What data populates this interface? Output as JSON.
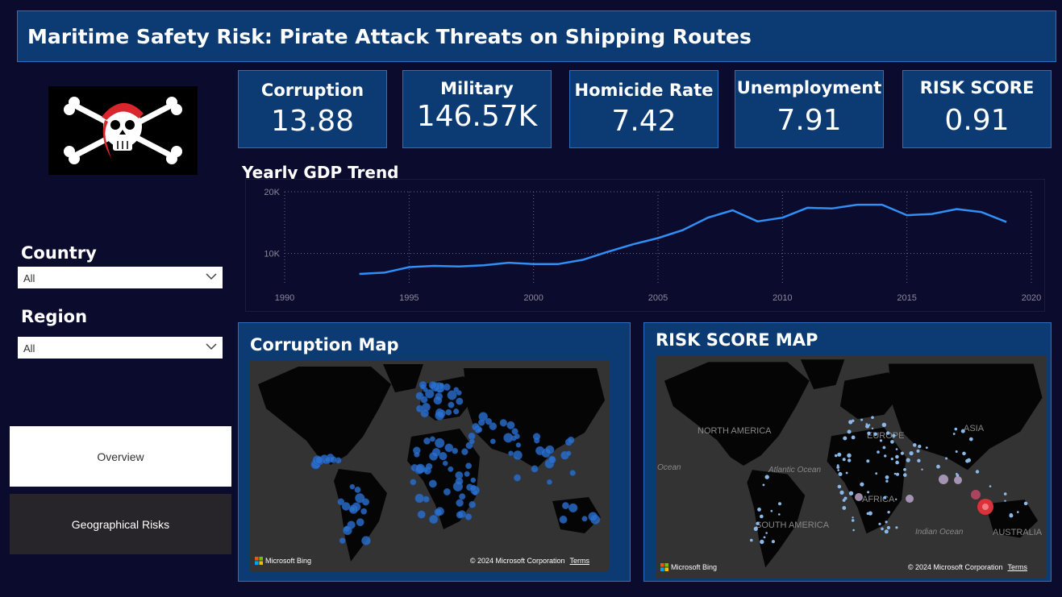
{
  "title": "Maritime Safety Risk: Pirate Attack Threats on Shipping Routes",
  "kpis": [
    {
      "label": "Corruption",
      "value": "13.88"
    },
    {
      "label": "Military",
      "value": "146.57K"
    },
    {
      "label": "Homicide Rate",
      "value": "7.42"
    },
    {
      "label": "Unemployment",
      "value": "7.91"
    },
    {
      "label": "RISK SCORE",
      "value": "0.91"
    }
  ],
  "filters": {
    "country": {
      "label": "Country",
      "value": "All"
    },
    "region": {
      "label": "Region",
      "value": "All"
    }
  },
  "nav": {
    "overview": "Overview",
    "geo": "Geographical Risks"
  },
  "chart_data": {
    "type": "line",
    "title": "Yearly GDP Trend",
    "x": [
      1993,
      1994,
      1995,
      1996,
      1997,
      1998,
      1999,
      2000,
      2001,
      2002,
      2003,
      2004,
      2005,
      2006,
      2007,
      2008,
      2009,
      2010,
      2011,
      2012,
      2013,
      2014,
      2015,
      2016,
      2017,
      2018,
      2019
    ],
    "values": [
      6700,
      6900,
      7800,
      8000,
      7900,
      8100,
      8500,
      8300,
      8300,
      9000,
      10300,
      11500,
      12500,
      13800,
      15800,
      17000,
      15200,
      15800,
      17400,
      17300,
      17900,
      17900,
      16200,
      16400,
      17200,
      16700,
      15100
    ],
    "x_ticks": [
      "1990",
      "1995",
      "2000",
      "2005",
      "2010",
      "2015",
      "2020"
    ],
    "y_ticks": [
      "10K",
      "20K"
    ],
    "xlim": [
      1990,
      2020
    ],
    "ylim": [
      5000,
      20000
    ],
    "grid": true,
    "color": "#2f8ff4"
  },
  "maps": {
    "corruption": {
      "title": "Corruption Map",
      "bing": "Microsoft Bing",
      "copyright": "© 2024 Microsoft Corporation",
      "terms": "Terms"
    },
    "risk": {
      "title": "RISK SCORE MAP",
      "bing": "Microsoft Bing",
      "copyright": "© 2024 Microsoft Corporation",
      "terms": "Terms",
      "labels": {
        "na": "NORTH AMERICA",
        "eu": "EUROPE",
        "asia": "ASIA",
        "ocean": "Ocean",
        "atl": "Atlantic Ocean",
        "africa": "AFRICA",
        "sa": "SOUTH AMERICA",
        "indian": "Indian Ocean",
        "aus": "AUSTRALIA"
      }
    }
  },
  "colors": {
    "accent": "#0c3b74",
    "border": "#2d6fc4",
    "background": "#0b0b2e",
    "line": "#2f8ff4",
    "risk_marker": "#d9323a"
  },
  "icons": {
    "logo": "pirate-skull-flag-icon",
    "dropdown": "chevron-down-icon",
    "bing": "microsoft-logo-icon"
  }
}
